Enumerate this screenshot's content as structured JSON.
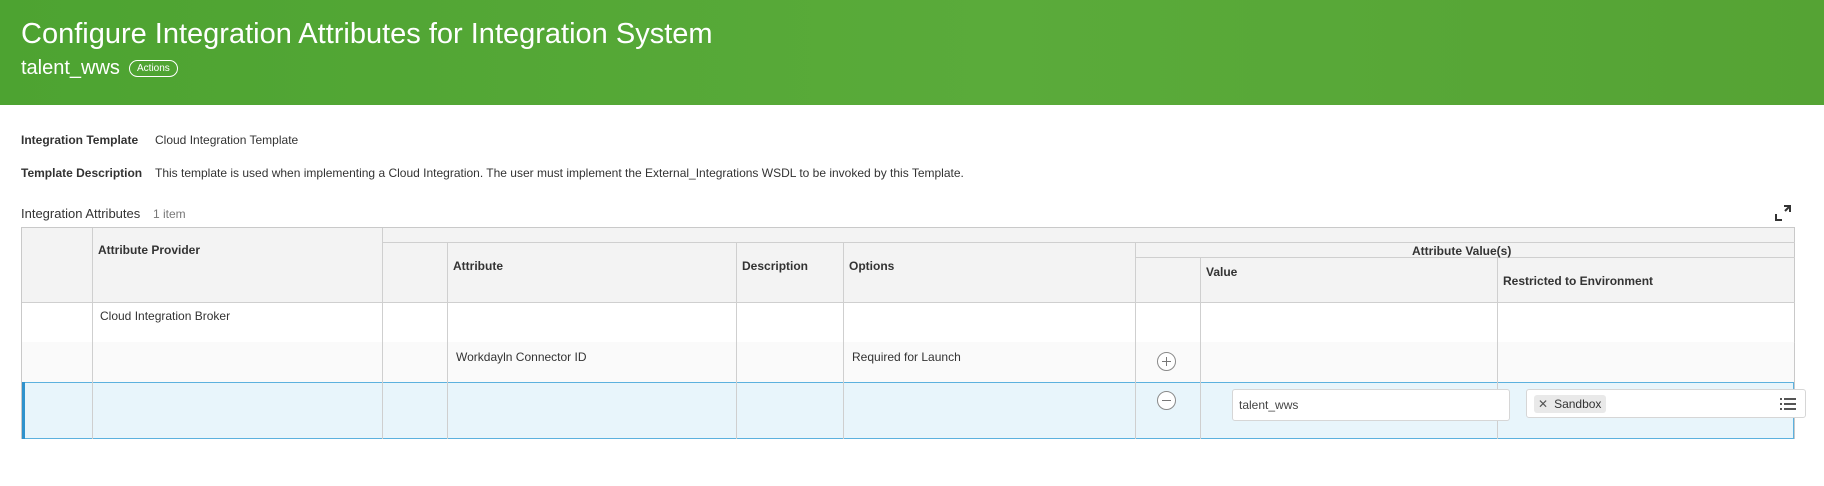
{
  "header": {
    "title": "Configure Integration Attributes for Integration System",
    "subtitle": "talent_wws",
    "actions_label": "Actions"
  },
  "details": {
    "template_label": "Integration Template",
    "template_value": "Cloud Integration Template",
    "description_label": "Template Description",
    "description_value": "This template is used when implementing a Cloud Integration.  The user must implement the External_Integrations WSDL to be invoked by this Template."
  },
  "grid": {
    "title": "Integration Attributes",
    "count": "1 item",
    "headers": {
      "provider": "Attribute Provider",
      "attribute": "Attribute",
      "description": "Description",
      "options": "Options",
      "group": "Attribute Value(s)",
      "value": "Value",
      "restricted": "Restricted to Environment"
    },
    "rows": [
      {
        "provider": "Cloud Integration Broker"
      },
      {
        "attribute": "Workdayln Connector ID",
        "options": "Required for Launch"
      },
      {
        "value": "talent_wws",
        "environment": "Sandbox"
      }
    ]
  },
  "icons": {
    "expand": "expand-icon",
    "add": "plus-circle-icon",
    "remove": "minus-circle-icon",
    "clear": "close-icon",
    "list": "list-icon"
  },
  "colors": {
    "header_green": "#55a334",
    "selected_row": "#e8f5fb",
    "selected_border": "#2f92cc"
  }
}
